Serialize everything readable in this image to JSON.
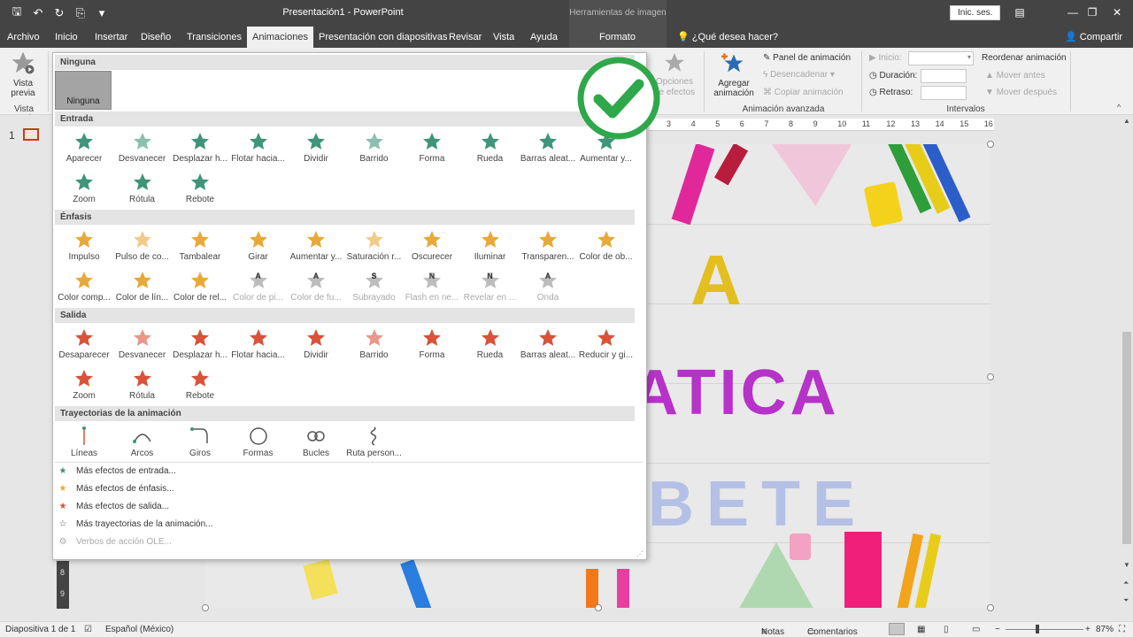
{
  "titlebar": {
    "title": "Presentación1  -  PowerPoint",
    "context_label": "Herramientas de imagen",
    "signin": "Inic. ses.",
    "qat": [
      {
        "icon": "save-icon",
        "glyph": "🖫"
      },
      {
        "icon": "undo-icon",
        "glyph": "↶"
      },
      {
        "icon": "redo-icon",
        "glyph": "↻"
      },
      {
        "icon": "slideshow-icon",
        "glyph": "⎘"
      },
      {
        "icon": "customize-icon",
        "glyph": "▾"
      }
    ],
    "window_buttons": [
      {
        "icon": "ribbon-options-icon",
        "glyph": "▤"
      },
      {
        "icon": "minimize-icon",
        "glyph": "—"
      },
      {
        "icon": "restore-icon",
        "glyph": "❐"
      },
      {
        "icon": "close-icon",
        "glyph": "✕"
      }
    ]
  },
  "tabs": [
    {
      "label": "Archivo",
      "active": false
    },
    {
      "label": "Inicio",
      "active": false
    },
    {
      "label": "Insertar",
      "active": false
    },
    {
      "label": "Diseño",
      "active": false
    },
    {
      "label": "Transiciones",
      "active": false
    },
    {
      "label": "Animaciones",
      "active": true
    },
    {
      "label": "Presentación con diapositivas",
      "active": false
    },
    {
      "label": "Revisar",
      "active": false
    },
    {
      "label": "Vista",
      "active": false
    },
    {
      "label": "Ayuda",
      "active": false
    },
    {
      "label": "Formato",
      "active": false
    }
  ],
  "tell_me": "¿Qué desea hacer?",
  "share": "Compartir",
  "ribbon": {
    "preview_label1": "Vista",
    "preview_label2": "previa",
    "preview_group": "Vista previa",
    "effect_options": "Opciones de efectos",
    "add_anim1": "Agregar",
    "add_anim2": "animación",
    "anim_panel": "Panel de animación",
    "trigger": "Desencadenar",
    "painter": "Copiar animación",
    "adv_group": "Animación avanzada",
    "start": "Inicio:",
    "duration": "Duración:",
    "delay": "Retraso:",
    "timing_group": "Intervalos",
    "reorder": "Reordenar animación",
    "move_earlier": "Mover antes",
    "move_later": "Mover después"
  },
  "ruler": [
    "3",
    "4",
    "5",
    "6",
    "7",
    "8",
    "9",
    "10",
    "11",
    "12",
    "13",
    "14",
    "15",
    "16"
  ],
  "vruler": [
    "8",
    "9"
  ],
  "thumb_number": "1",
  "slide": {
    "line1": "A",
    "line2": "ATICA",
    "line3": "BETE"
  },
  "gallery": {
    "none_header": "Ninguna",
    "none_item": "Ninguna",
    "sections": [
      {
        "title": "Entrada",
        "color": "#3f9479",
        "items": [
          {
            "label": "Aparecer",
            "icon": "appear-icon"
          },
          {
            "label": "Desvanecer",
            "icon": "fade-icon"
          },
          {
            "label": "Desplazar h...",
            "icon": "fly-in-icon"
          },
          {
            "label": "Flotar hacia...",
            "icon": "float-in-icon"
          },
          {
            "label": "Dividir",
            "icon": "split-icon"
          },
          {
            "label": "Barrido",
            "icon": "wipe-icon"
          },
          {
            "label": "Forma",
            "icon": "shape-icon"
          },
          {
            "label": "Rueda",
            "icon": "wheel-icon"
          },
          {
            "label": "Barras aleat...",
            "icon": "random-bars-icon"
          },
          {
            "label": "Aumentar y...",
            "icon": "grow-turn-icon"
          },
          {
            "label": "Zoom",
            "icon": "zoom-icon"
          },
          {
            "label": "Rótula",
            "icon": "swivel-icon"
          },
          {
            "label": "Rebote",
            "icon": "bounce-icon"
          }
        ]
      },
      {
        "title": "Énfasis",
        "color": "#e8a93a",
        "items": [
          {
            "label": "Impulso",
            "icon": "pulse-icon"
          },
          {
            "label": "Pulso de co...",
            "icon": "color-pulse-icon"
          },
          {
            "label": "Tambalear",
            "icon": "teeter-icon"
          },
          {
            "label": "Girar",
            "icon": "spin-icon"
          },
          {
            "label": "Aumentar y...",
            "icon": "grow-shrink-icon"
          },
          {
            "label": "Saturación r...",
            "icon": "desaturate-icon"
          },
          {
            "label": "Oscurecer",
            "icon": "darken-icon"
          },
          {
            "label": "Iluminar",
            "icon": "lighten-icon"
          },
          {
            "label": "Transparen...",
            "icon": "transparency-icon"
          },
          {
            "label": "Color de ob...",
            "icon": "object-color-icon"
          },
          {
            "label": "Color comp...",
            "icon": "complementary-color-icon"
          },
          {
            "label": "Color de lín...",
            "icon": "line-color-icon"
          },
          {
            "label": "Color de rel...",
            "icon": "fill-color-icon"
          },
          {
            "label": "Color de pi...",
            "icon": "brush-color-icon",
            "disabled": true,
            "letter": "A"
          },
          {
            "label": "Color de fu...",
            "icon": "font-color-icon",
            "disabled": true,
            "letter": "A"
          },
          {
            "label": "Subrayado",
            "icon": "underline-icon",
            "disabled": true,
            "letter": "S"
          },
          {
            "label": "Flash en ne...",
            "icon": "bold-flash-icon",
            "disabled": true,
            "letter": "N"
          },
          {
            "label": "Revelar en ...",
            "icon": "bold-reveal-icon",
            "disabled": true,
            "letter": "N"
          },
          {
            "label": "Onda",
            "icon": "wave-icon",
            "disabled": true,
            "letter": "A"
          }
        ]
      },
      {
        "title": "Salida",
        "color": "#d9523a",
        "items": [
          {
            "label": "Desaparecer",
            "icon": "disappear-icon"
          },
          {
            "label": "Desvanecer",
            "icon": "fade-out-icon"
          },
          {
            "label": "Desplazar h...",
            "icon": "fly-out-icon"
          },
          {
            "label": "Flotar hacia...",
            "icon": "float-out-icon"
          },
          {
            "label": "Dividir",
            "icon": "split-out-icon"
          },
          {
            "label": "Barrido",
            "icon": "wipe-out-icon"
          },
          {
            "label": "Forma",
            "icon": "shape-out-icon"
          },
          {
            "label": "Rueda",
            "icon": "wheel-out-icon"
          },
          {
            "label": "Barras aleat...",
            "icon": "random-bars-out-icon"
          },
          {
            "label": "Reducir y gi...",
            "icon": "shrink-turn-icon"
          },
          {
            "label": "Zoom",
            "icon": "zoom-out-icon"
          },
          {
            "label": "Rótula",
            "icon": "swivel-out-icon"
          },
          {
            "label": "Rebote",
            "icon": "bounce-out-icon"
          }
        ]
      },
      {
        "title": "Trayectorias de la animación",
        "color": "#555555",
        "items": [
          {
            "label": "Líneas",
            "icon": "lines-path-icon"
          },
          {
            "label": "Arcos",
            "icon": "arcs-path-icon"
          },
          {
            "label": "Giros",
            "icon": "turns-path-icon"
          },
          {
            "label": "Formas",
            "icon": "shapes-path-icon"
          },
          {
            "label": "Bucles",
            "icon": "loops-path-icon"
          },
          {
            "label": "Ruta person...",
            "icon": "custom-path-icon"
          }
        ]
      }
    ],
    "more": [
      {
        "label": "Más efectos de entrada...",
        "icon": "more-entrance-icon",
        "color": "#3f9479",
        "disabled": false
      },
      {
        "label": "Más efectos de énfasis...",
        "icon": "more-emphasis-icon",
        "color": "#e8a93a",
        "disabled": false
      },
      {
        "label": "Más efectos de salida...",
        "icon": "more-exit-icon",
        "color": "#d9523a",
        "disabled": false
      },
      {
        "label": "Más trayectorias de la animación...",
        "icon": "more-paths-icon",
        "color": "#555555",
        "disabled": false
      },
      {
        "label": "Verbos de acción OLE...",
        "icon": "ole-verbs-icon",
        "color": "#aaaaaa",
        "disabled": true
      }
    ]
  },
  "status": {
    "slide": "Diapositiva 1 de 1",
    "language": "Español (México)",
    "notes": "Notas",
    "comments": "Comentarios",
    "zoom": "87%"
  },
  "colors": {
    "ribbon_dark": "#444444",
    "check_green": "#2ea84a",
    "entrance": "#3f9479",
    "emphasis": "#e8a93a",
    "exit": "#d9523a",
    "title_a": "#e2bf1f",
    "title_atica": "#b632c8",
    "title_bete": "#b4c0e6"
  }
}
